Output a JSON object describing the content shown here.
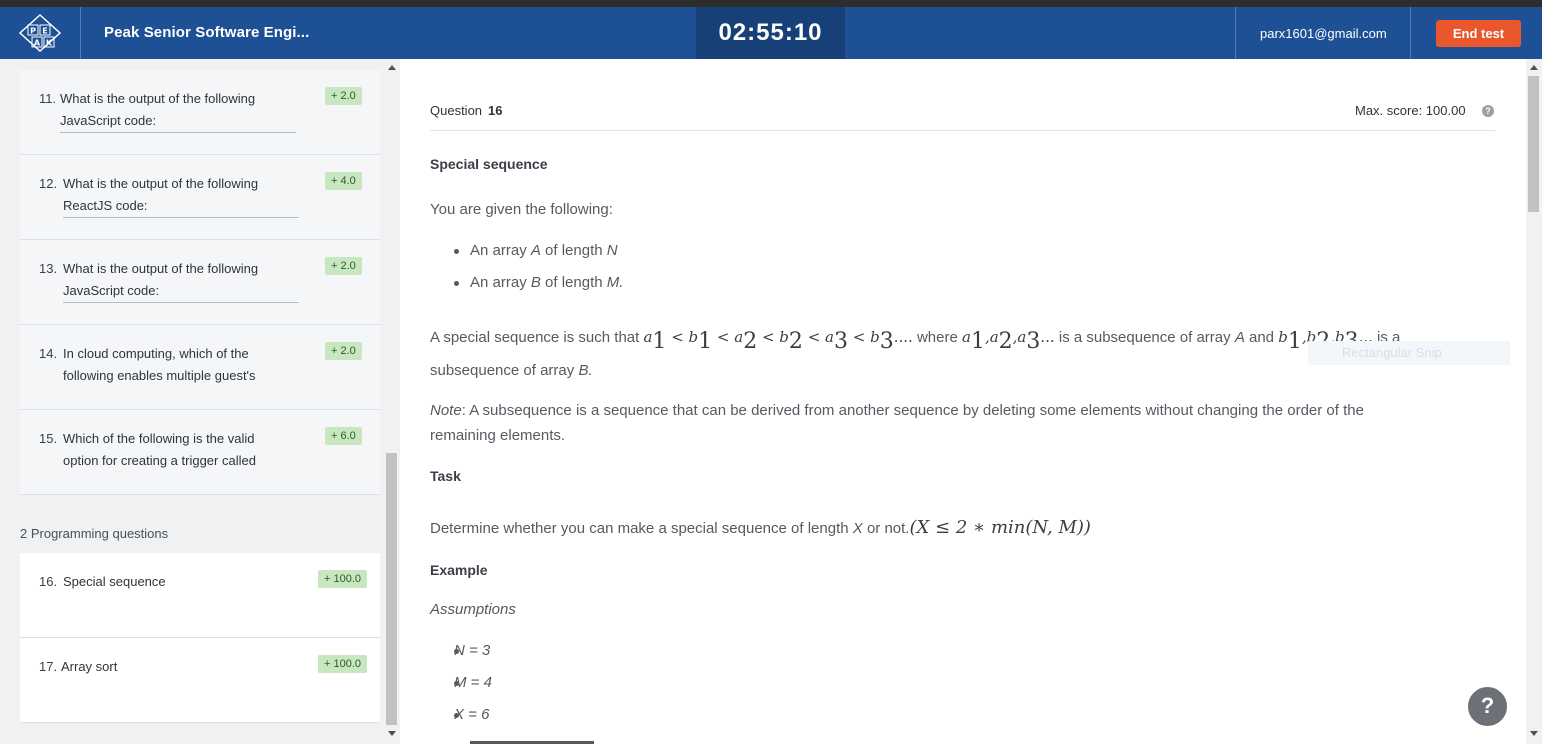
{
  "header": {
    "title": "Peak Senior Software Engi...",
    "timer": "02:55:10",
    "email": "parx1601@gmail.com",
    "end_button": "End test",
    "logo_letters": [
      "P",
      "E",
      "A",
      "K"
    ]
  },
  "sidebar": {
    "questions": [
      {
        "num": "11.",
        "line1": "What is the output of the following",
        "line2": "JavaScript code:",
        "score": "+ 2.0"
      },
      {
        "num": "12.",
        "line1": "What is the output of the following",
        "line2": "ReactJS code:",
        "score": "+ 4.0"
      },
      {
        "num": "13.",
        "line1": "What is the output of the following",
        "line2": "JavaScript code:",
        "score": "+ 2.0"
      },
      {
        "num": "14.",
        "line1": "In cloud computing, which of the",
        "line2": "following enables multiple guest's",
        "score": "+ 2.0"
      },
      {
        "num": "15.",
        "line1": "Which of the following is the valid",
        "line2": "option for creating a trigger called",
        "score": "+ 6.0"
      }
    ],
    "section_label": "2 Programming questions",
    "programming": [
      {
        "num": "16.",
        "title": "Special sequence",
        "score": "+ 100.0"
      },
      {
        "num": "17.",
        "title": "Array sort",
        "score": "+ 100.0"
      }
    ]
  },
  "question": {
    "label": "Question",
    "number": "16",
    "max_score": "Max. score: 100.00",
    "title": "Special sequence",
    "intro": "You are given the following:",
    "bullets": [
      {
        "pre": "An array ",
        "var": "A",
        "post": " of length ",
        "var2": "N",
        "end": ""
      },
      {
        "pre": "An array ",
        "var": "B",
        "post": " of length ",
        "var2": "M.",
        "end": ""
      }
    ],
    "special_pre": "A special sequence is such that",
    "special_mid": "where",
    "special_mid2": "is a subsequence of array",
    "special_arrA": "A",
    "special_and": "and",
    "special_end": "is a",
    "special_line2": "subsequence of array",
    "special_arrB": "B.",
    "note_label": "Note",
    "note_text": ": A subsequence is a sequence that can be derived from another sequence by deleting some elements without changing the order of the",
    "note_text2": "remaining elements.",
    "task_title": "Task",
    "task_text": "Determine whether you can make a special sequence of length",
    "task_var": "X",
    "task_text2": "or not.",
    "task_math": "(X ≤ 2 ∗ min(N, M))",
    "example_title": "Example",
    "assumptions": "Assumptions",
    "assumption_items": [
      "N = 3",
      "M = 4",
      "X = 6"
    ],
    "snip_text": "Rectangular Snip"
  }
}
